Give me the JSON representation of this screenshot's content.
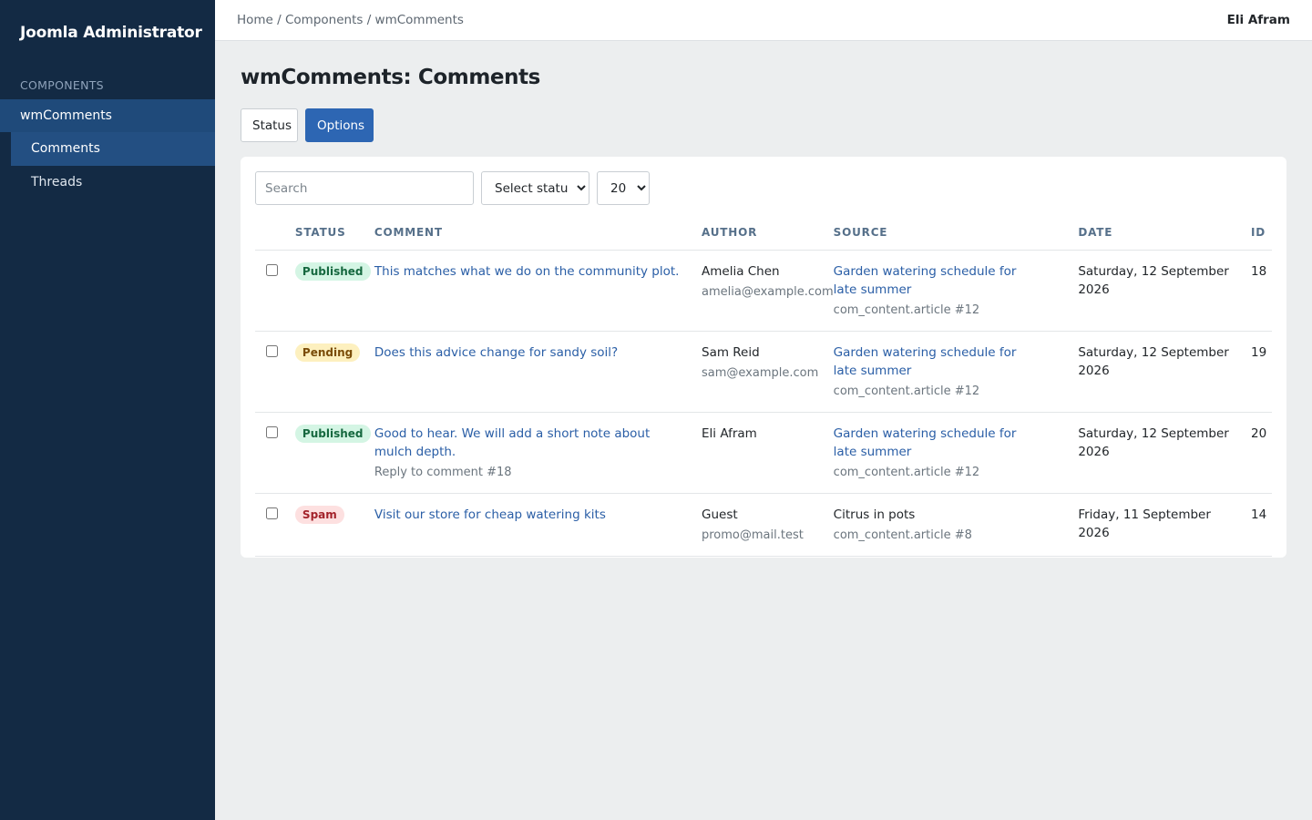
{
  "sidebar": {
    "brand": "Joomla Administrator",
    "section_label": "COMPONENTS",
    "parent": "wmComments",
    "children": [
      {
        "label": "Comments"
      },
      {
        "label": "Threads"
      }
    ]
  },
  "topbar": {
    "breadcrumb": "Home / Components / wmComments",
    "user": "Eli Afram"
  },
  "page": {
    "title": "wmComments: Comments"
  },
  "toolbar": {
    "status_label": "Status",
    "options_label": "Options"
  },
  "filters": {
    "search_placeholder": "Search",
    "status_selected": "Select status",
    "limit_selected": "20"
  },
  "table": {
    "headers": {
      "status": "STATUS",
      "comment": "COMMENT",
      "author": "AUTHOR",
      "source": "SOURCE",
      "date": "DATE",
      "id": "ID"
    },
    "rows": [
      {
        "status": "Published",
        "status_bg": "#d4f5e4",
        "status_fg": "#16683f",
        "comment": "This matches what we do on the community plot.",
        "comment_sub": "",
        "author": "Amelia Chen",
        "author_email": "amelia@example.com",
        "source": "Garden watering schedule for late summer",
        "source_is_link": true,
        "source_ref": "com_content.article #12",
        "date": "Saturday, 12 September 2026",
        "id": "18"
      },
      {
        "status": "Pending",
        "status_bg": "#fdf0bf",
        "status_fg": "#7a4c08",
        "comment": "Does this advice change for sandy soil?",
        "comment_sub": "",
        "author": "Sam Reid",
        "author_email": "sam@example.com",
        "source": "Garden watering schedule for late summer",
        "source_is_link": true,
        "source_ref": "com_content.article #12",
        "date": "Saturday, 12 September 2026",
        "id": "19"
      },
      {
        "status": "Published",
        "status_bg": "#d4f5e4",
        "status_fg": "#16683f",
        "comment": "Good to hear. We will add a short note about mulch depth.",
        "comment_sub": "Reply to comment #18",
        "author": "Eli Afram",
        "author_email": "",
        "source": "Garden watering schedule for late summer",
        "source_is_link": true,
        "source_ref": "com_content.article #12",
        "date": "Saturday, 12 September 2026",
        "id": "20"
      },
      {
        "status": "Spam",
        "status_bg": "#fde0e0",
        "status_fg": "#a3222a",
        "comment": "Visit our store for cheap watering kits",
        "comment_sub": "",
        "author": "Guest",
        "author_email": "promo@mail.test",
        "source": "Citrus in pots",
        "source_is_link": false,
        "source_ref": "com_content.article #8",
        "date": "Friday, 11 September 2026",
        "id": "14"
      }
    ]
  }
}
